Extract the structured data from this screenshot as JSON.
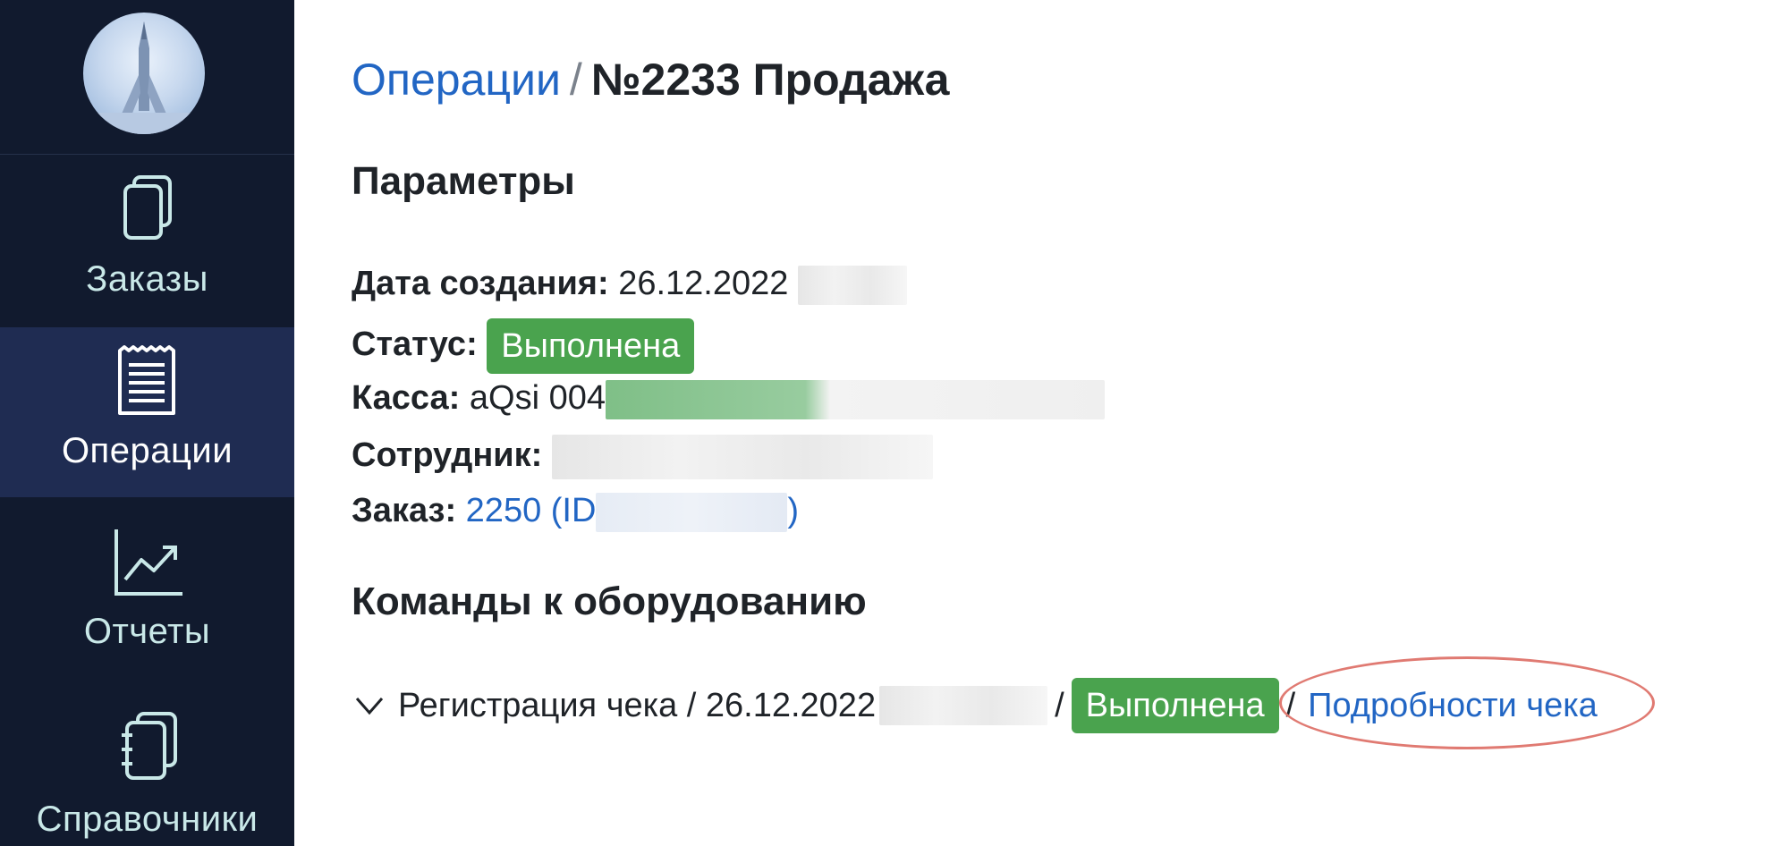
{
  "sidebar": {
    "items": [
      {
        "label": "Заказы",
        "icon": "orders-icon"
      },
      {
        "label": "Операции",
        "icon": "receipt-icon",
        "active": true
      },
      {
        "label": "Отчеты",
        "icon": "chart-icon"
      },
      {
        "label": "Справочники",
        "icon": "notebook-icon"
      }
    ]
  },
  "breadcrumb": {
    "parent": "Операции",
    "separator": "/",
    "current": "№2233 Продажа"
  },
  "params": {
    "title": "Параметры",
    "created_label": "Дата создания:",
    "created_value": "26.12.2022",
    "status_label": "Статус:",
    "status_value": "Выполнена",
    "register_label": "Касса:",
    "register_value": "aQsi 004",
    "employee_label": "Сотрудник:",
    "order_label": "Заказ:",
    "order_link": "2250 (ID",
    "order_link_end": ")"
  },
  "commands": {
    "title": "Команды к оборудованию",
    "item_label": "Регистрация чека / 26.12.2022",
    "separator": "/",
    "status": "Выполнена",
    "separator2": "/",
    "details_link": "Подробности чека"
  },
  "colors": {
    "sidebar_bg": "#111a2e",
    "sidebar_active": "#1f2c52",
    "link": "#2266c4",
    "status_green": "#4aa34e",
    "highlight_ring": "#e07a72"
  }
}
